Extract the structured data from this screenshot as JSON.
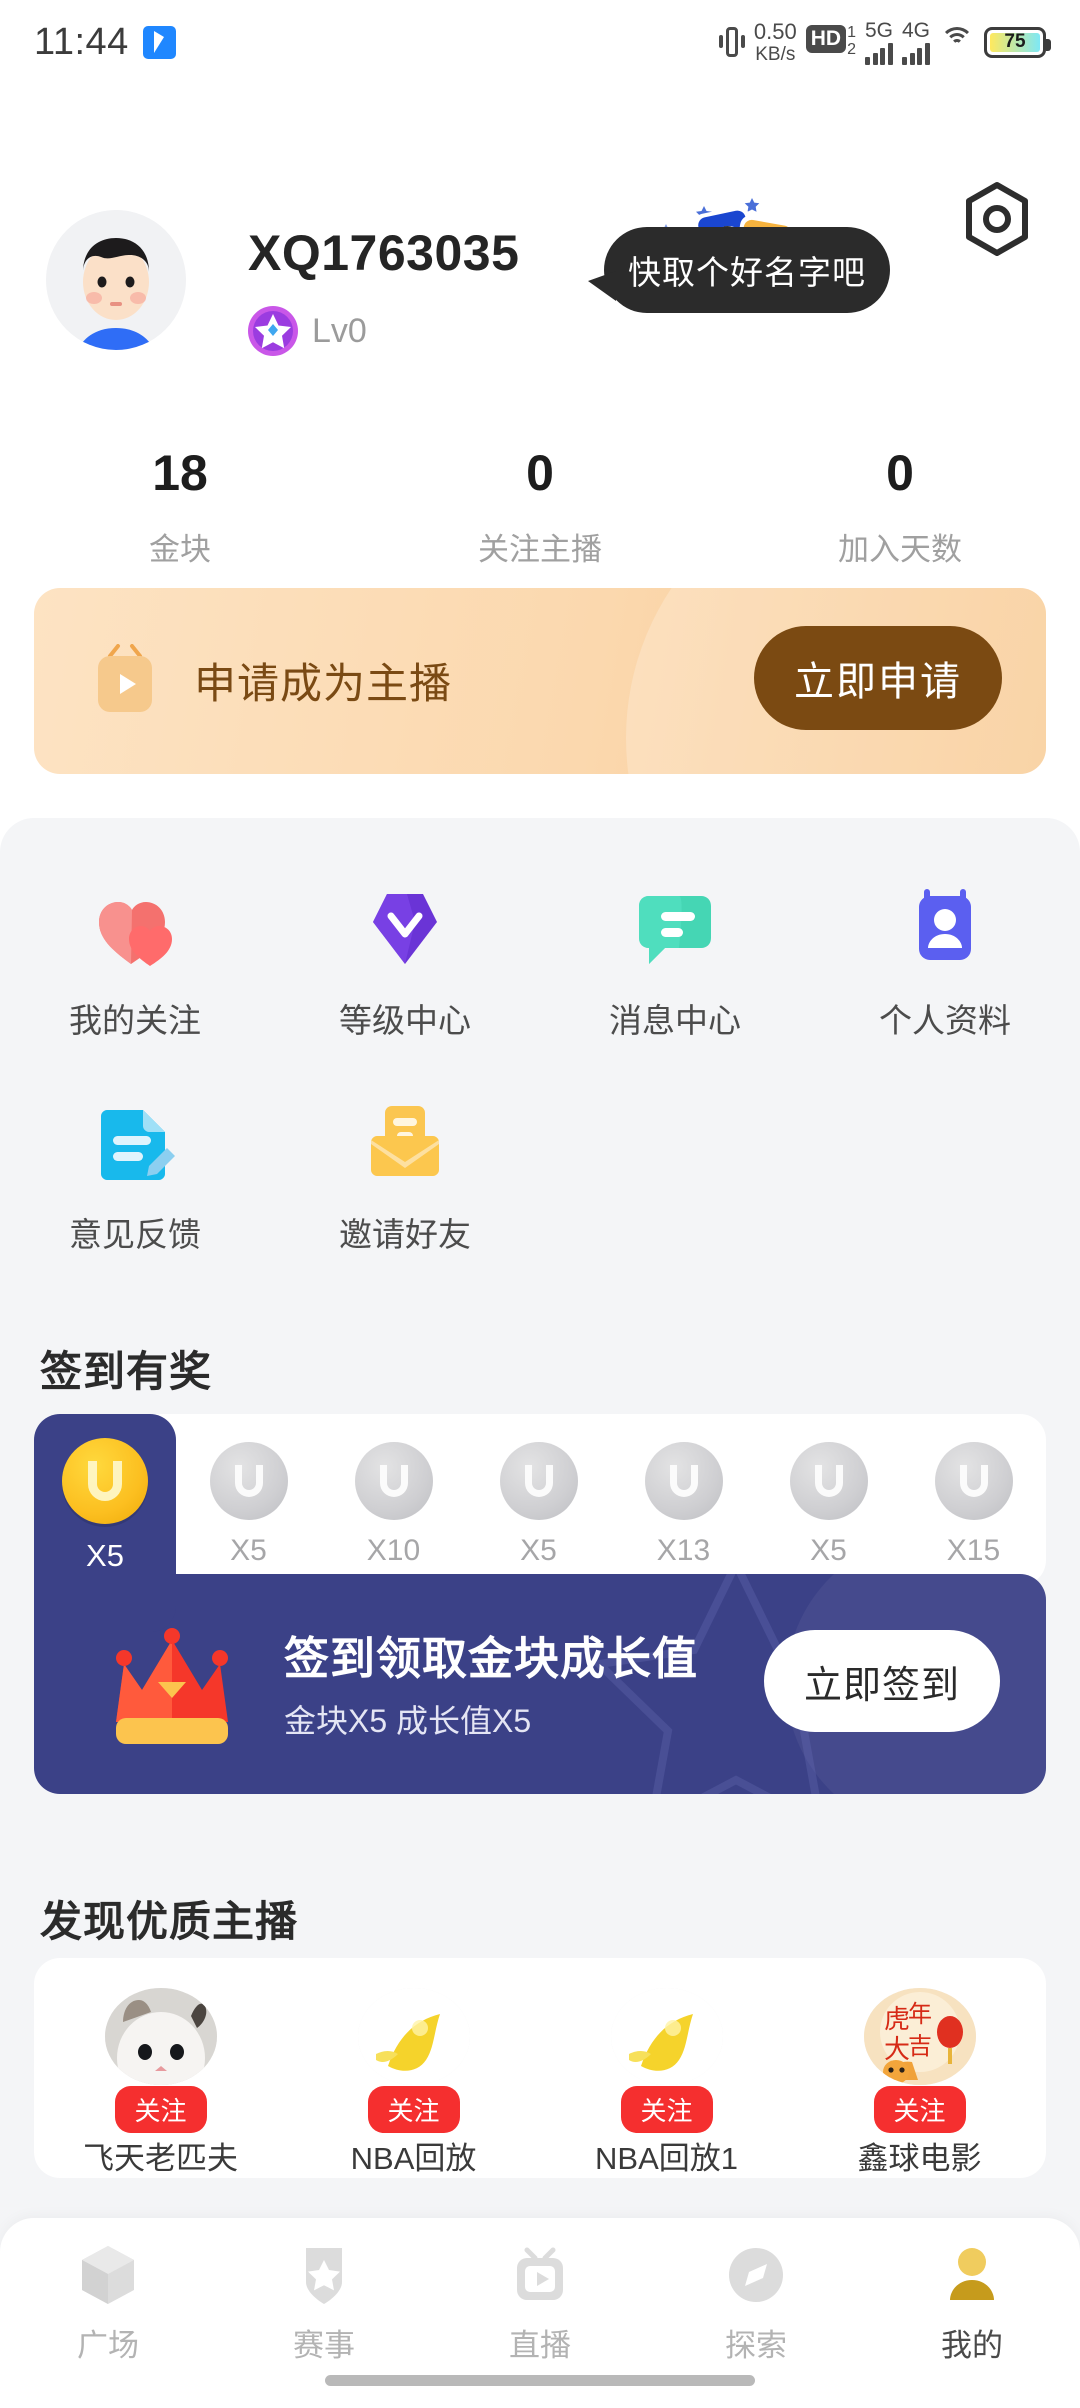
{
  "status_bar": {
    "time": "11:44",
    "app_icon": "telegram-icon",
    "vibrate_icon": "vibrate-icon",
    "net_speed_value": "0.50",
    "net_speed_unit": "KB/s",
    "hd_label": "HD",
    "hd_sim1": "1",
    "hd_sim2": "2",
    "signal_1_label": "5G",
    "signal_2_label": "4G",
    "wifi_icon": "wifi-icon",
    "battery_level": "75"
  },
  "header": {
    "username": "XQ1763035",
    "level": "Lv0",
    "level_badge_icon": "star-level-badge-icon",
    "avatar_icon": "user-avatar",
    "tip_bubble": "快取个好名字吧",
    "settings_icon": "hexagon-settings-icon"
  },
  "stats": [
    {
      "value": "18",
      "label": "金块"
    },
    {
      "value": "0",
      "label": "关注主播"
    },
    {
      "value": "0",
      "label": "加入天数"
    }
  ],
  "apply_banner": {
    "icon": "live-tv-icon",
    "title": "申请成为主播",
    "button": "立即申请"
  },
  "grid": [
    {
      "label": "我的关注",
      "icon": "hearts-icon",
      "color": "#f4716e"
    },
    {
      "label": "等级中心",
      "icon": "level-diamond-icon",
      "color": "#6a34d6"
    },
    {
      "label": "消息中心",
      "icon": "chat-bubble-icon",
      "color": "#45d6b4"
    },
    {
      "label": "个人资料",
      "icon": "id-card-icon",
      "color": "#5b5ff0"
    },
    {
      "label": "意见反馈",
      "icon": "feedback-document-icon",
      "color": "#18b9ec"
    },
    {
      "label": "邀请好友",
      "icon": "invite-envelope-icon",
      "color": "#fcc74e"
    }
  ],
  "signin": {
    "section_title": "签到有奖",
    "days": [
      {
        "reward": "X5",
        "state": "active"
      },
      {
        "reward": "X5",
        "state": "locked"
      },
      {
        "reward": "X10",
        "state": "locked"
      },
      {
        "reward": "X5",
        "state": "locked"
      },
      {
        "reward": "X13",
        "state": "locked"
      },
      {
        "reward": "X5",
        "state": "locked"
      },
      {
        "reward": "X15",
        "state": "locked"
      }
    ],
    "banner_icon": "crown-icon",
    "banner_title": "签到领取金块成长值",
    "banner_sub": "金块X5  成长值X5",
    "banner_button": "立即签到"
  },
  "discover": {
    "section_title": "发现优质主播",
    "follow_label": "关注",
    "anchors": [
      {
        "name": "飞天老匹夫",
        "avatar": "cat-photo"
      },
      {
        "name": "NBA回放",
        "avatar": "yellow-flame-logo"
      },
      {
        "name": "NBA回放1",
        "avatar": "yellow-flame-logo"
      },
      {
        "name": "鑫球电影",
        "avatar": "tiger-new-year-photo"
      }
    ]
  },
  "bottom_nav": [
    {
      "label": "广场",
      "icon": "cube-icon",
      "active": false
    },
    {
      "label": "赛事",
      "icon": "shield-star-icon",
      "active": false
    },
    {
      "label": "直播",
      "icon": "live-tv-play-icon",
      "active": false
    },
    {
      "label": "探索",
      "icon": "compass-icon",
      "active": false
    },
    {
      "label": "我的",
      "icon": "person-icon",
      "active": true
    }
  ],
  "colors": {
    "accent_gold": "#c9a227",
    "signin_navy": "#3b4187",
    "follow_red": "#f52f2f",
    "banner_peach": "#fbd8ae",
    "sheet_bg": "#f4f5f7"
  }
}
